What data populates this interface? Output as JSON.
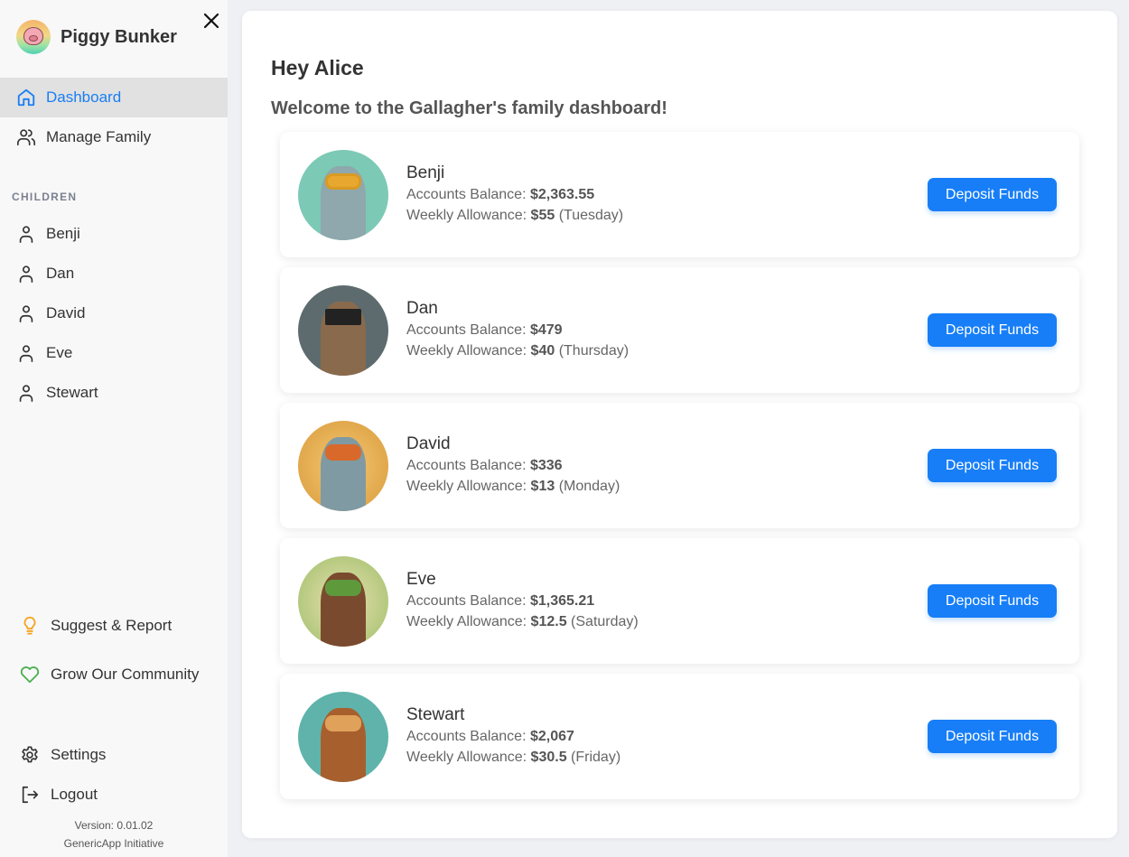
{
  "app": {
    "title": "Piggy Bunker",
    "version": "Version: 0.01.02",
    "org": "GenericApp Initiative"
  },
  "nav": {
    "items": [
      {
        "label": "Dashboard",
        "icon": "home-icon",
        "active": true
      },
      {
        "label": "Manage Family",
        "icon": "users-icon",
        "active": false
      }
    ],
    "children_label": "CHILDREN",
    "children": [
      {
        "label": "Benji",
        "icon": "user-icon"
      },
      {
        "label": "Dan",
        "icon": "user-icon"
      },
      {
        "label": "David",
        "icon": "user-icon"
      },
      {
        "label": "Eve",
        "icon": "user-icon"
      },
      {
        "label": "Stewart",
        "icon": "user-icon"
      }
    ],
    "extras": [
      {
        "label": "Suggest & Report",
        "icon": "lightbulb-icon"
      },
      {
        "label": "Grow Our Community",
        "icon": "heart-icon"
      }
    ],
    "bottom": [
      {
        "label": "Settings",
        "icon": "gear-icon"
      },
      {
        "label": "Logout",
        "icon": "logout-icon"
      }
    ]
  },
  "colors": {
    "accent": "#1a7ef2",
    "button": "#177ef7",
    "lightbulb": "#f5a623",
    "heart": "#4caf50"
  },
  "main": {
    "greeting": "Hey Alice",
    "welcome": "Welcome to the Gallagher's family dashboard!",
    "balance_label": "Accounts Balance: ",
    "allowance_label": "Weekly Allowance: ",
    "deposit_label": "Deposit Funds",
    "children": [
      {
        "name": "Benji",
        "balance": "$2,363.55",
        "allowance": "$55",
        "day": "(Tuesday)",
        "avatar": "dolphin-snorkel-avatar"
      },
      {
        "name": "Dan",
        "balance": "$479",
        "allowance": "$40",
        "day": "(Thursday)",
        "avatar": "owl-graduate-avatar"
      },
      {
        "name": "David",
        "balance": "$336",
        "allowance": "$13",
        "day": "(Monday)",
        "avatar": "fox-sweater-avatar"
      },
      {
        "name": "Eve",
        "balance": "$1,365.21",
        "allowance": "$12.5",
        "day": "(Saturday)",
        "avatar": "flower-girl-avatar"
      },
      {
        "name": "Stewart",
        "balance": "$2,067",
        "allowance": "$30.5",
        "day": "(Friday)",
        "avatar": "lion-scout-avatar"
      }
    ]
  }
}
